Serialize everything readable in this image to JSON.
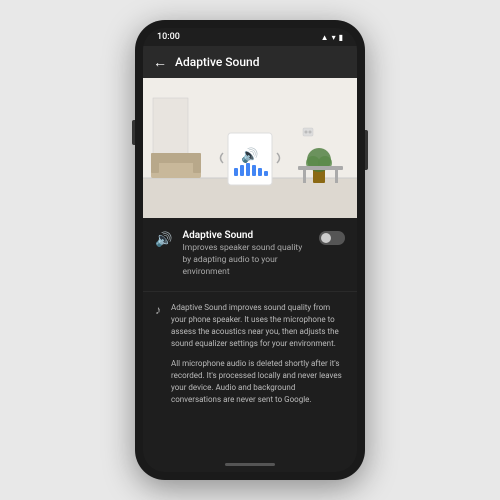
{
  "statusBar": {
    "time": "10:00"
  },
  "nav": {
    "backLabel": "←",
    "title": "Adaptive Sound"
  },
  "adaptiveSoundSetting": {
    "title": "Adaptive Sound",
    "description": "Improves speaker sound quality by adapting audio to your environment",
    "toggleEnabled": false
  },
  "infoSection": {
    "paragraph1": "Adaptive Sound improves sound quality from your phone speaker. It uses the microphone to assess the acoustics near you, then adjusts the sound equalizer settings for your environment.",
    "paragraph2": "All microphone audio is deleted shortly after it's recorded. It's processed locally and never leaves your device. Audio and background conversations are never sent to Google."
  },
  "icons": {
    "back": "←",
    "speaker": "🔊",
    "music": "♪",
    "wifi": "▲",
    "battery": "▮",
    "signal": "▲"
  }
}
